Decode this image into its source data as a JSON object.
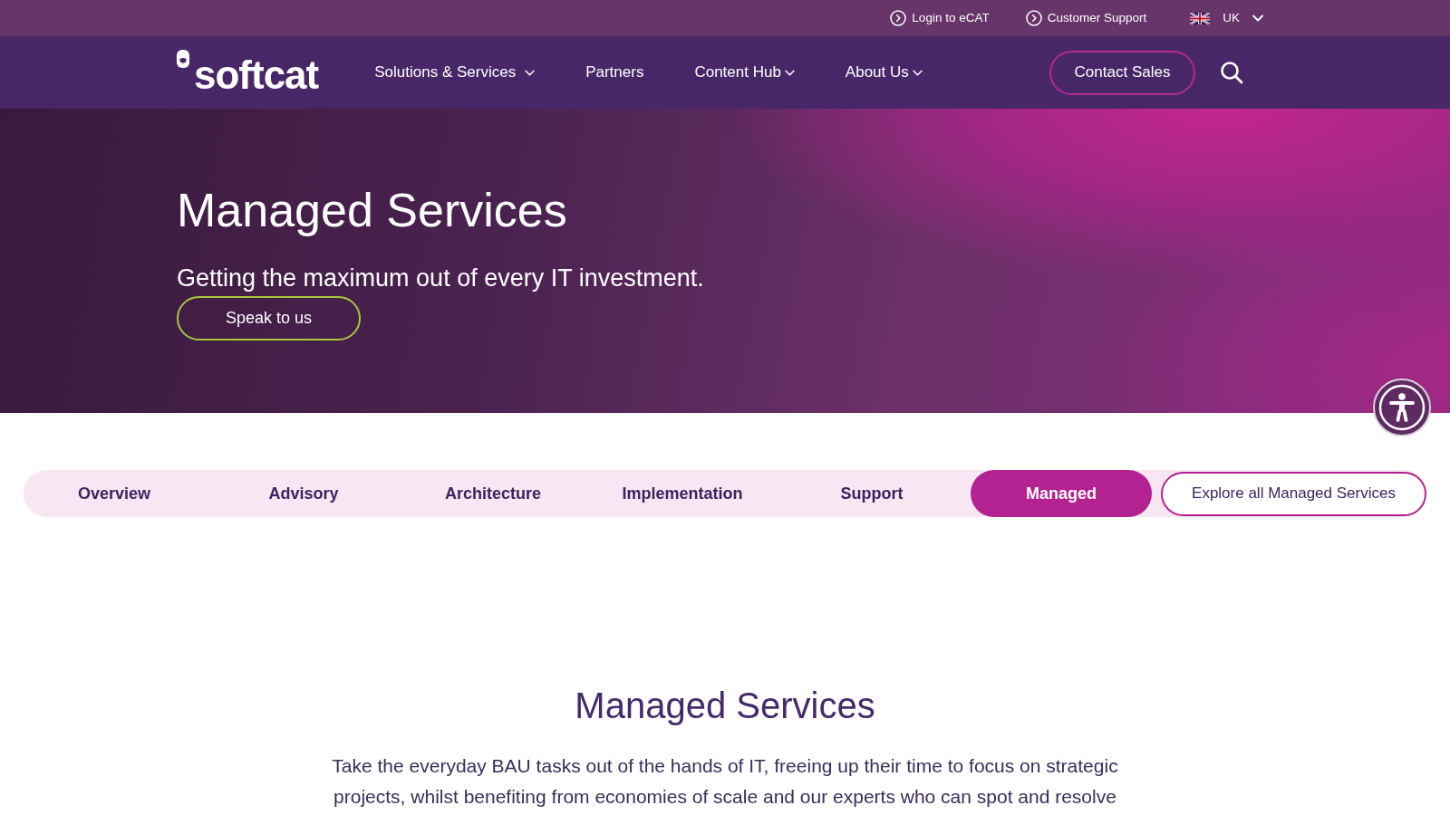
{
  "top_bar": {
    "links": [
      {
        "label": "Login to eCAT"
      },
      {
        "label": "Customer Support"
      }
    ],
    "region": "UK"
  },
  "header": {
    "logo": "softcat",
    "nav": [
      {
        "label": "Solutions & Services",
        "has_menu": true
      },
      {
        "label": "Partners",
        "has_menu": false
      },
      {
        "label": "Content Hub",
        "has_menu": true
      },
      {
        "label": "About Us",
        "has_menu": true
      }
    ],
    "contact_button": "Contact Sales"
  },
  "hero": {
    "title": "Managed Services",
    "subtitle": "Getting the maximum out of every IT investment.",
    "button": "Speak to us"
  },
  "tabs": [
    {
      "label": "Overview",
      "selected": false
    },
    {
      "label": "Advisory",
      "selected": false
    },
    {
      "label": "Architecture",
      "selected": false
    },
    {
      "label": "Implementation",
      "selected": false
    },
    {
      "label": "Support",
      "selected": false
    },
    {
      "label": "Managed",
      "selected": true
    }
  ],
  "explore_button": "Explore all Managed Services",
  "intro": {
    "heading": "Managed Services",
    "text": "Take the everyday BAU tasks out of the hands of IT, freeing up their time to focus on strategic projects, whilst benefiting from economies of scale and our experts who can spot and resolve"
  }
}
